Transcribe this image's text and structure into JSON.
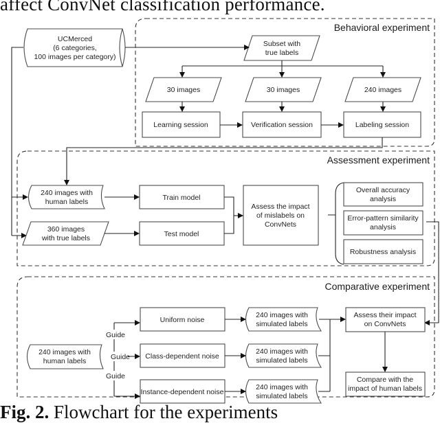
{
  "header_text": "affect ConvNet classification performance.",
  "caption": {
    "label": "Fig. 2.",
    "text": "Flowchart for the experiments"
  },
  "source": {
    "lines": [
      "UCMerced",
      "(6 categories,",
      "100 images per category)"
    ]
  },
  "behavioral": {
    "title": "Behavioral experiment",
    "subset": [
      "Subset with",
      "true labels"
    ],
    "inputs": [
      [
        "30 images"
      ],
      [
        "30 images"
      ],
      [
        "240 images"
      ]
    ],
    "sessions": [
      [
        "Learning session"
      ],
      [
        "Verification session"
      ],
      [
        "Labeling session"
      ]
    ]
  },
  "assessment": {
    "title": "Assessment experiment",
    "human_labels": [
      "240 images with",
      "human labels"
    ],
    "true_labels": [
      "360 images",
      "with true labels"
    ],
    "train": [
      "Train model"
    ],
    "test": [
      "Test model"
    ],
    "assess": [
      "Assess the impact",
      "of mislabels on",
      "ConvNets"
    ],
    "analyses": [
      [
        "Overall accuracy",
        "analysis"
      ],
      [
        "Error-pattern similarity",
        "analysis"
      ],
      [
        "Robustness analysis"
      ]
    ]
  },
  "comparative": {
    "title": "Comparative experiment",
    "human_labels": [
      "240 images with",
      "human labels"
    ],
    "guide_label": "Guide",
    "noises": [
      [
        "Uniform noise"
      ],
      [
        "Class-dependent noise"
      ],
      [
        "Instance-dependent noise"
      ]
    ],
    "simulated": [
      [
        "240 images with",
        "simulated labels"
      ],
      [
        "240 images with",
        "simulated labels"
      ],
      [
        "240 images with",
        "simulated labels"
      ]
    ],
    "assess": [
      "Assess their impact",
      "on ConvNets"
    ],
    "compare": [
      "Compare with the",
      "impact of human labels"
    ]
  }
}
